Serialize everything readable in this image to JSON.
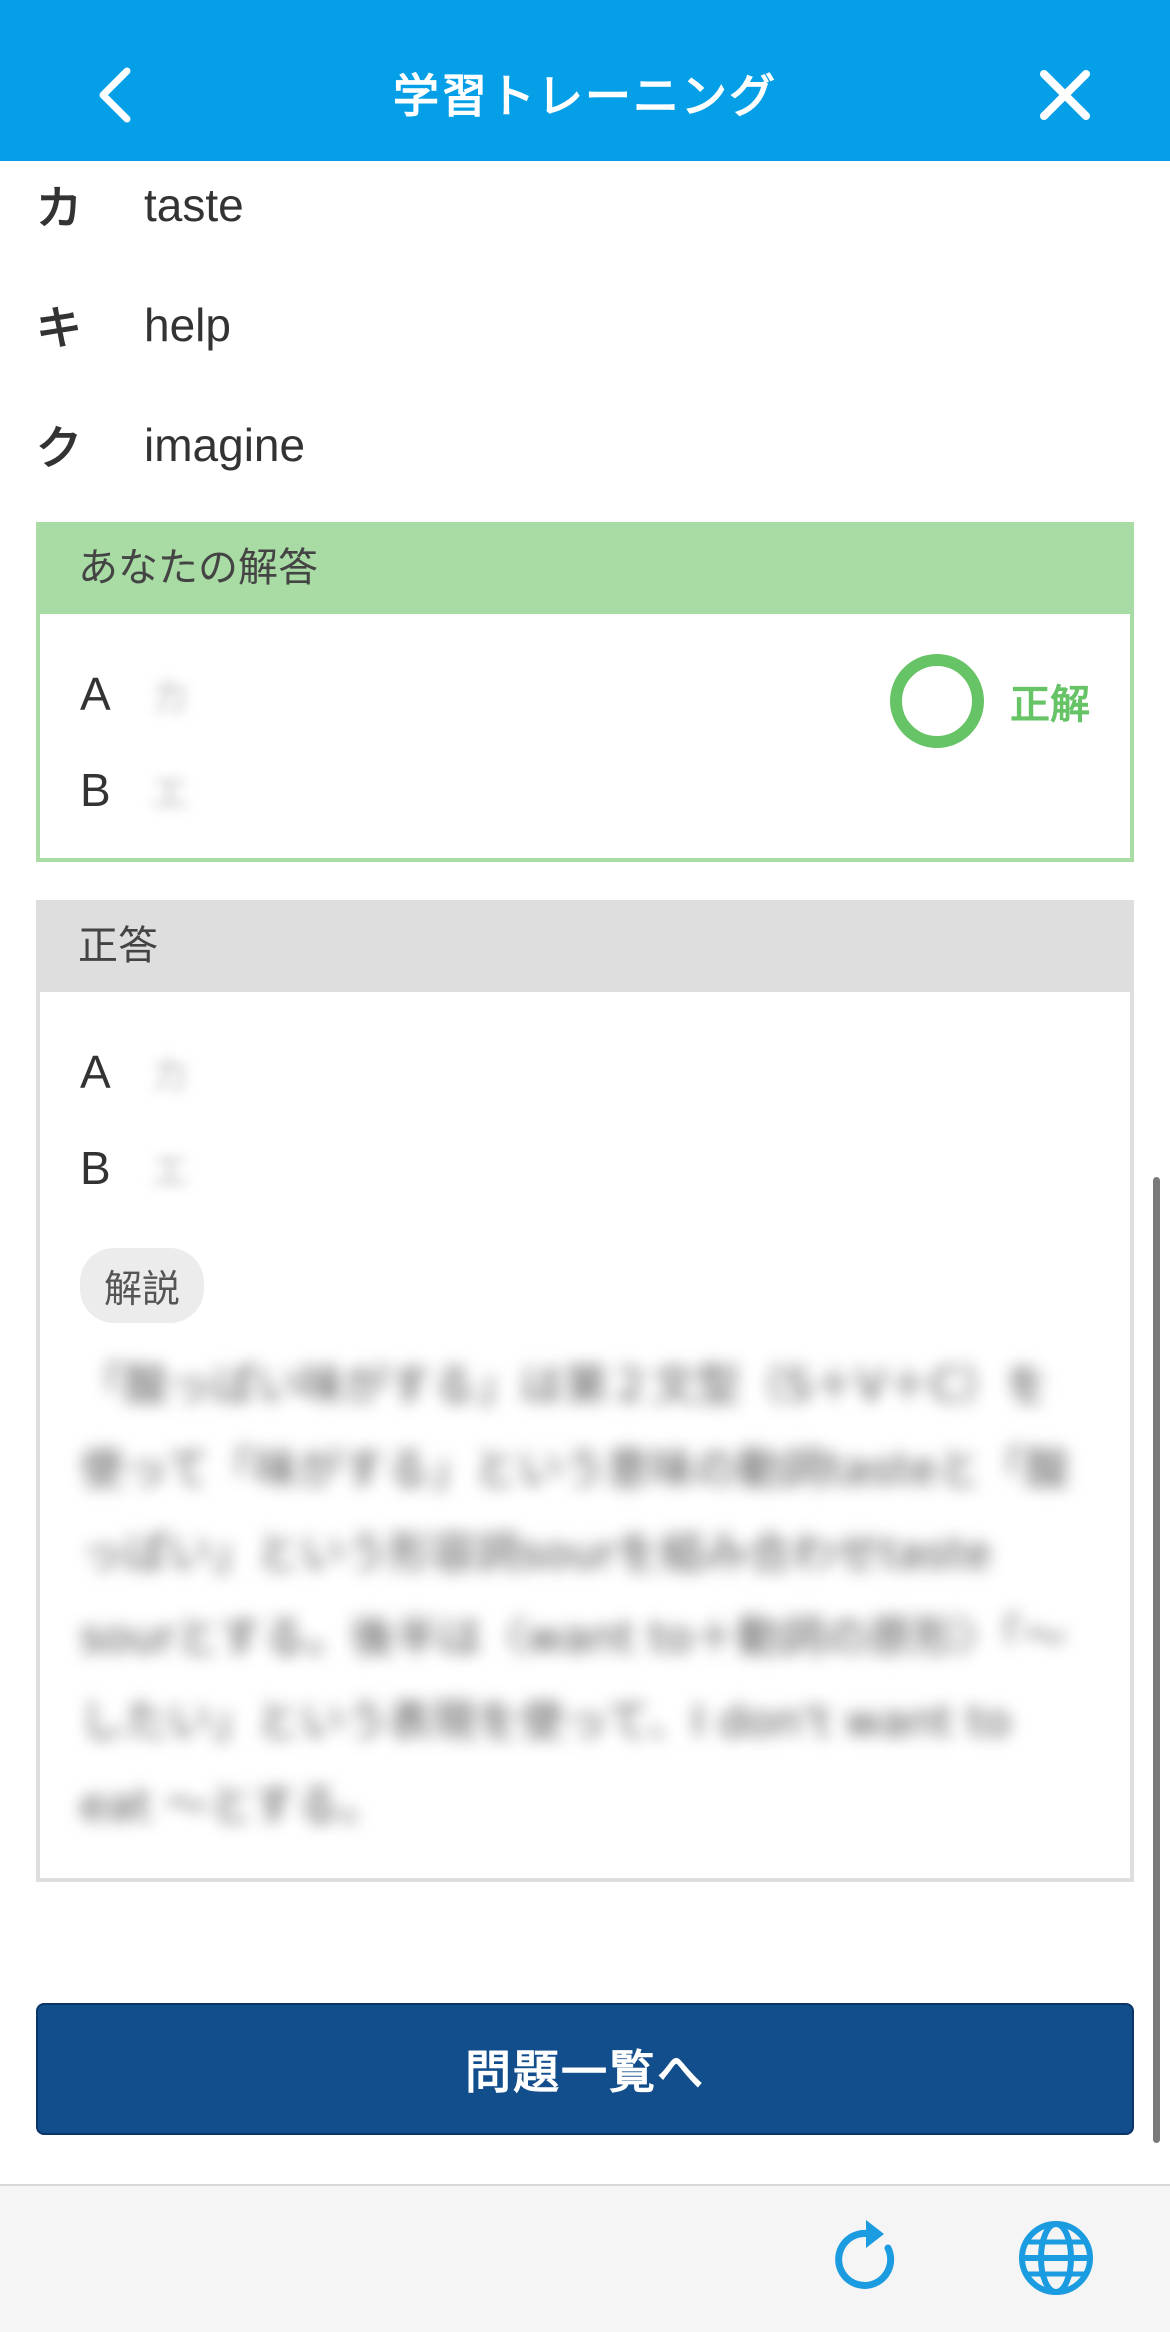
{
  "header": {
    "title": "学習トレーニング"
  },
  "choices": [
    {
      "key": "カ",
      "word": "taste"
    },
    {
      "key": "キ",
      "word": "help"
    },
    {
      "key": "ク",
      "word": "imagine"
    }
  ],
  "your_answer": {
    "heading": "あなたの解答",
    "rows": [
      {
        "label": "A",
        "value": "カ"
      },
      {
        "label": "B",
        "value": "エ"
      }
    ],
    "result": "正解"
  },
  "correct_answer": {
    "heading": "正答",
    "rows": [
      {
        "label": "A",
        "value": "カ"
      },
      {
        "label": "B",
        "value": "エ"
      }
    ],
    "tag": "解説",
    "explanation": "「酸っぱい味がする」は第２文型（S＋V＋C）を使って「味がする」という意味の動詞tasteと「酸っぱい」という形容詞sourを組み合わせtaste sourとする。後半は〈want to＋動詞の原形〉「～したい」という表現を使って、I don't want to eat ～とする。"
  },
  "actions": {
    "to_list": "問題一覧へ"
  },
  "colors": {
    "header": "#049fe6",
    "correct": "#66c366",
    "button": "#124d8c"
  },
  "toolbar": {
    "icons": [
      "refresh-icon",
      "globe-icon"
    ]
  }
}
